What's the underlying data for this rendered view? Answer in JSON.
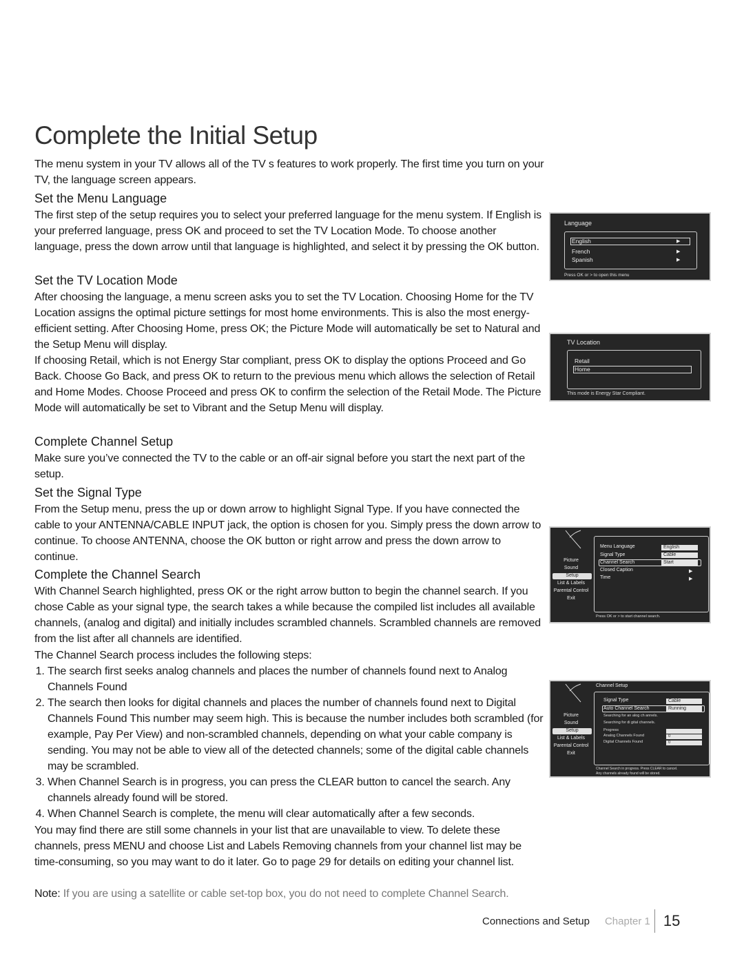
{
  "page": {
    "title": "Complete the Initial Setup",
    "intro": "The menu system in your TV allows all of the TV s features to work properly. The first time you turn on your TV, the language screen appears.",
    "sections": {
      "menu_language": {
        "heading": "Set the Menu Language",
        "body": "The first step of the setup requires you to select your preferred language for the menu system. If English is your preferred language, press OK and proceed to set the TV Location Mode. To choose another language, press the down arrow until that language is highlighted, and select it by pressing the OK button."
      },
      "tv_location": {
        "heading": "Set the TV Location Mode",
        "body1": "After choosing the language, a menu screen asks you to set the TV Location. Choosing  Home  for the TV Location assigns the optimal picture settings for most home environments. This is also the most energy-efficient setting. After Choosing  Home,  press OK; the Picture Mode will automatically be set to  Natural  and the Setup Menu will display.",
        "body2": "If choosing  Retail,  which is not Energy Star compliant, press OK to display the options  Proceed and  Go Back.  Choose  Go Back,  and press OK to return to the previous menu which allows the selection of Retail and Home Modes. Choose  Proceed  and press OK to confirm the selection of the Retail Mode. The Picture Mode will automatically be set to  Vibrant  and the Setup Menu will display."
      },
      "channel_setup": {
        "heading": "Complete Channel Setup",
        "body": "Make sure you’ve connected the TV to the cable or an off-air signal before you start the next part of the setup."
      },
      "signal_type": {
        "heading": "Set the Signal Type",
        "body": "From the Setup menu, press the up or down arrow to highlight Signal Type. If you have connected the cable to your ANTENNA/CABLE INPUT jack, the option is chosen for you. Simply press the down arrow to continue. To choose ANTENNA, choose the OK button or right arrow and press the down arrow to continue."
      },
      "channel_search": {
        "heading": "Complete the Channel Search",
        "body": "With Channel Search highlighted, press OK or the right arrow button to begin the channel search. If you chose Cable as your signal type, the search takes a while because the compiled list includes all available channels, (analog and digital) and initially includes scrambled channels. Scrambled channels are removed from the list after all channels are identified.",
        "steps_intro": "The Channel Search process includes the following steps:",
        "steps": [
          "The search first seeks analog channels and places the number of channels found next to Analog Channels Found",
          "The search then looks for digital channels and places the number of channels found next to Digital Channels Found This number may seem high. This is because the number includes both scrambled (for example, Pay Per View) and non-scrambled channels, depending on what your cable company is sending. You may not be able to view all of the detected channels; some of the digital cable channels may be scrambled.",
          "When Channel Search is in progress, you can press the CLEAR button to cancel the search. Any channels already found will be stored.",
          "When Channel Search is complete, the menu will clear automatically after a few seconds."
        ],
        "after": "You may find there are still some channels in your list that are unavailable to view. To delete these channels, press MENU and choose List and Labels Removing channels from your channel list may be time-consuming, so you may want to do it later. Go to page 29 for details on editing your channel list.",
        "note_label": "Note:",
        "note_text": " If you are using a satellite or cable set-top box, you do not need to complete Channel Search."
      }
    }
  },
  "screens": {
    "language": {
      "title": "Language",
      "items": [
        "English",
        "French",
        "Spanish"
      ],
      "selected": "English",
      "footer": "Press OK or > to open this menu"
    },
    "tv_location": {
      "title": "TV Location",
      "items": [
        "Retail",
        "Home"
      ],
      "selected": "Home",
      "footer": "This mode is Energy Star Compliant."
    },
    "setup_menu": {
      "sidebar": [
        "Picture",
        "Sound",
        "Setup",
        "List & Labels",
        "Parental Control",
        "Exit"
      ],
      "sidebar_selected": "Setup",
      "rows": [
        {
          "label": "Menu Language",
          "value": "English"
        },
        {
          "label": "Signal Type",
          "value": "Cable"
        },
        {
          "label": "Channel Search",
          "value": "Start"
        },
        {
          "label": "Closed Caption",
          "value": "▶"
        },
        {
          "label": "Time",
          "value": "▶"
        }
      ],
      "footer": "Press OK or  > to start channel search."
    },
    "channel_setup": {
      "title": "Channel Setup",
      "sidebar": [
        "Picture",
        "Sound",
        "Setup",
        "List & Labels",
        "Parental Control",
        "Exit"
      ],
      "sidebar_selected": "Setup",
      "signal_type_label": "Signal Type",
      "signal_type_value": "Cable",
      "auto_search_label": "Auto Channel Search",
      "auto_search_value": "Running",
      "status1": "Searching for an  alog ch annels.",
      "status2": "Searching for di  gital channels.",
      "progress_label": "Progress",
      "progress_value": "",
      "analog_label": "Analog Channels Found",
      "analog_value": "0",
      "digital_label": "Digital Channels Found",
      "digital_value": "0",
      "footer1": "Channel Search in progress. Press CLEAR       to cancel.",
      "footer2": "Any channels   already found will be stored."
    }
  },
  "footer": {
    "section": "Connections and Setup",
    "chapter": "Chapter 1",
    "page_number": "15"
  }
}
